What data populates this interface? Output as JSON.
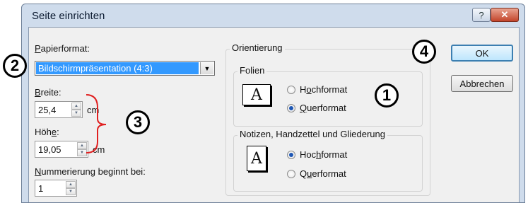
{
  "window": {
    "title": "Seite einrichten",
    "help_glyph": "?",
    "close_glyph": "✕"
  },
  "paper": {
    "label_first": "P",
    "label_rest": "apierformat:",
    "value": "Bildschirmpräsentation (4:3)"
  },
  "width": {
    "label_first": "B",
    "label_rest": "reite:",
    "value": "25,4",
    "unit": "cm"
  },
  "height": {
    "label_pre": "Höh",
    "label_u": "e",
    "label_post": ":",
    "value": "19,05",
    "unit": "cm"
  },
  "numbering": {
    "label_first": "N",
    "label_rest": "ummerierung beginnt bei:",
    "value": "1"
  },
  "orientation": {
    "title": "Orientierung",
    "slides": {
      "title": "Folien",
      "portrait_pre": "H",
      "portrait_u": "o",
      "portrait_post": "chformat",
      "landscape_u": "Q",
      "landscape_post": "uerformat",
      "selected": "landscape"
    },
    "notes": {
      "title": "Notizen, Handzettel und Gliederung",
      "portrait_pre": "Hoc",
      "portrait_u": "h",
      "portrait_post": "format",
      "landscape_pre": "Q",
      "landscape_u": "u",
      "landscape_post": "erformat",
      "selected": "portrait"
    }
  },
  "buttons": {
    "ok": "OK",
    "cancel": "Abbrechen"
  },
  "callouts": [
    "1",
    "2",
    "3",
    "4"
  ],
  "icon_letter": "A"
}
